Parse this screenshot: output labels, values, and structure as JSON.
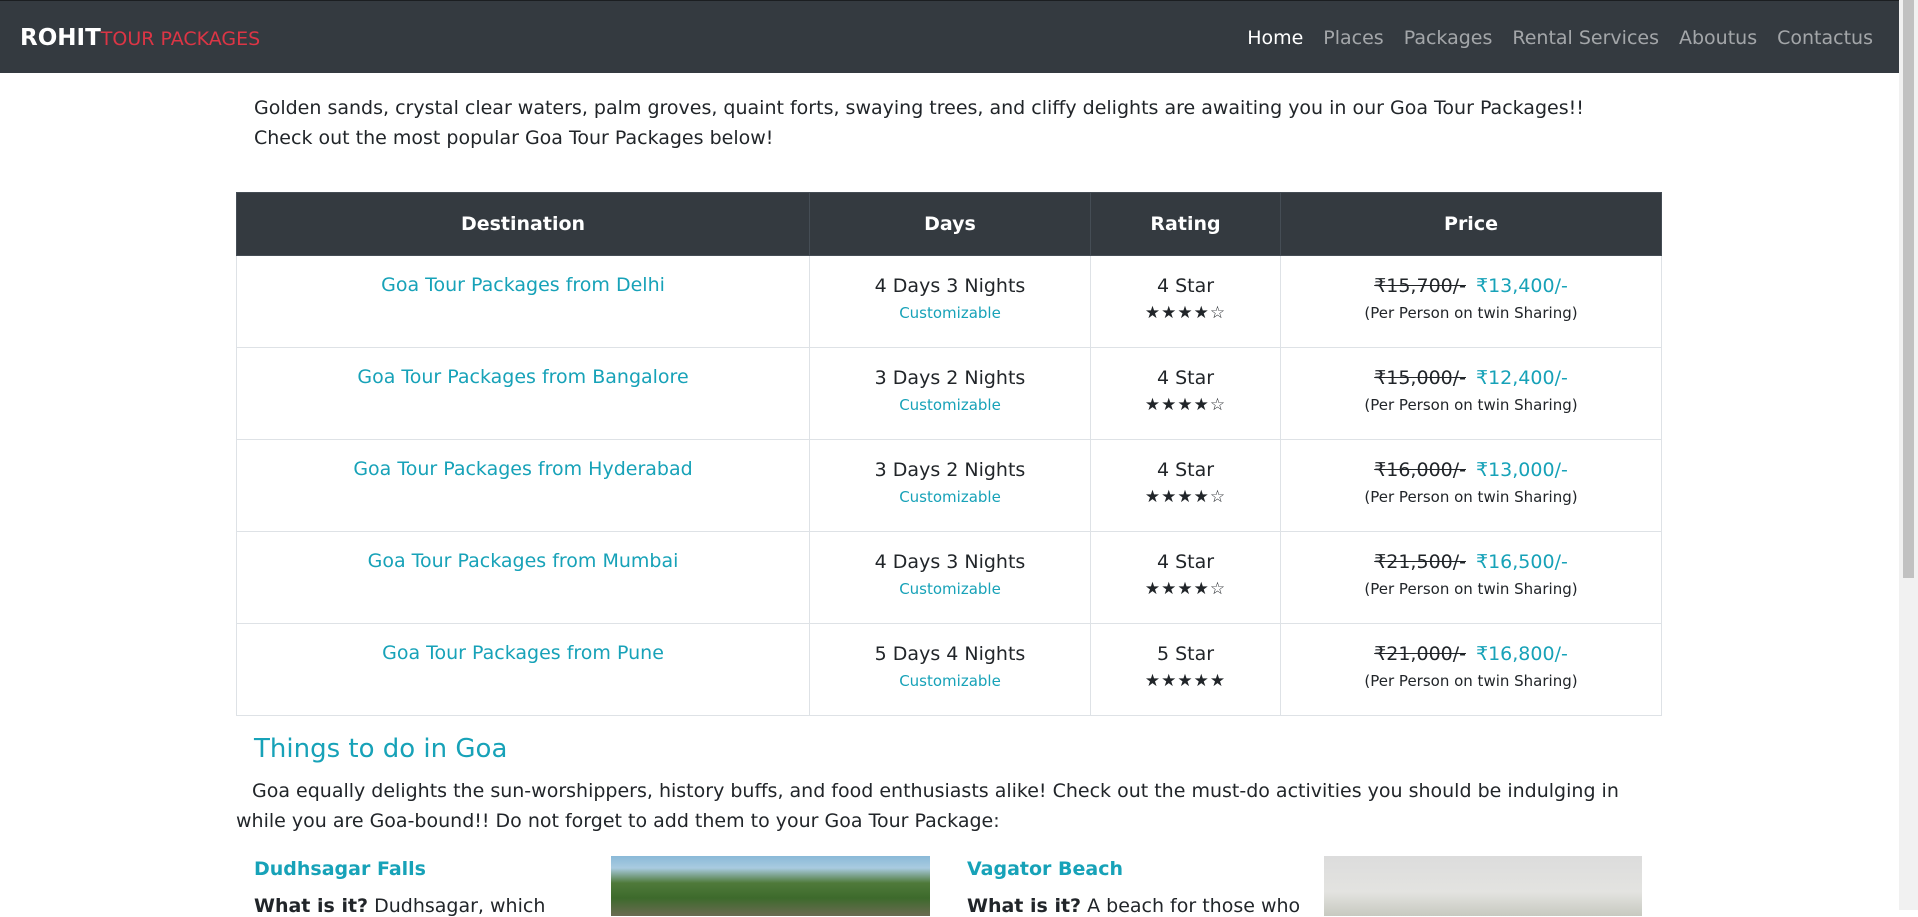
{
  "brand": {
    "main": "ROHIT",
    "sub": "TOUR PACKAGES"
  },
  "nav": [
    "Home",
    "Places",
    "Packages",
    "Rental Services",
    "Aboutus",
    "Contactus"
  ],
  "intro": "Golden sands, crystal clear waters, palm groves, quaint forts, swaying trees, and cliffy delights are awaiting you in our Goa Tour Packages!! Check out the most popular Goa Tour Packages below!",
  "table": {
    "headers": [
      "Destination",
      "Days",
      "Rating",
      "Price"
    ],
    "rows": [
      {
        "destination": "Goa Tour Packages from Delhi",
        "days": "4 Days 3 Nights",
        "days_note": "Customizable",
        "rating": "4 Star",
        "stars": "★★★★☆",
        "old_price": "₹15,700/-",
        "new_price": "₹13,400/-",
        "price_note": "(Per Person on twin Sharing)"
      },
      {
        "destination": "Goa Tour Packages from Bangalore",
        "days": "3 Days 2 Nights",
        "days_note": "Customizable",
        "rating": "4 Star",
        "stars": "★★★★☆",
        "old_price": "₹15,000/-",
        "new_price": "₹12,400/-",
        "price_note": "(Per Person on twin Sharing)"
      },
      {
        "destination": "Goa Tour Packages from Hyderabad",
        "days": "3 Days 2 Nights",
        "days_note": "Customizable",
        "rating": "4 Star",
        "stars": "★★★★☆",
        "old_price": "₹16,000/-",
        "new_price": "₹13,000/-",
        "price_note": "(Per Person on twin Sharing)"
      },
      {
        "destination": "Goa Tour Packages from Mumbai",
        "days": "4 Days 3 Nights",
        "days_note": "Customizable",
        "rating": "4 Star",
        "stars": "★★★★☆",
        "old_price": "₹21,500/-",
        "new_price": "₹16,500/-",
        "price_note": "(Per Person on twin Sharing)"
      },
      {
        "destination": "Goa Tour Packages from Pune",
        "days": "5 Days 4 Nights",
        "days_note": "Customizable",
        "rating": "5 Star",
        "stars": "★★★★★",
        "old_price": "₹21,000/-",
        "new_price": "₹16,800/-",
        "price_note": "(Per Person on twin Sharing)"
      }
    ]
  },
  "things": {
    "title": "Things to do in Goa",
    "text": "Goa equally delights the sun-worshippers, history buffs, and food enthusiasts alike! Check out the must-do activities you should be indulging in while you are Goa-bound!! Do not forget to add them to your Goa Tour Package:",
    "cards": [
      {
        "title": "Dudhsagar Falls",
        "label": "What is it?",
        "text": " Dudhsagar, which"
      },
      {
        "title": "Vagator Beach",
        "label": "What is it?",
        "text": " A beach for those who"
      }
    ]
  }
}
